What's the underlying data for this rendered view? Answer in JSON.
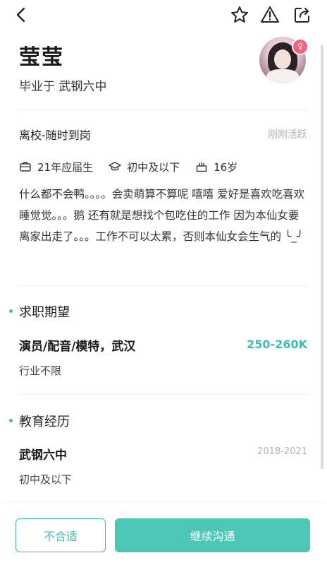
{
  "profile": {
    "name": "莹莹",
    "graduated": "毕业于 武钢六中",
    "gender_symbol": "♀"
  },
  "status": {
    "title": "离校-随时到岗",
    "active": "刚刚活跃"
  },
  "info": {
    "graduate_type": "21年应届生",
    "education": "初中及以下",
    "age": "16岁"
  },
  "bio": "什么都不会鸭。。。。会卖萌算不算呢 嘻嘻 爱好是喜欢吃喜欢睡觉觉。。。鹅 还有就是想找个包吃住的工作 因为本仙女要离家出走了。。。工作不可以太累，否则本仙女会生气的 ╰_╯",
  "expectation": {
    "section_title": "求职期望",
    "job": "演员/配音/模特，武汉",
    "salary": "250-260K",
    "industry": "行业不限"
  },
  "education_history": {
    "section_title": "教育经历",
    "school": "武钢六中",
    "years": "2018-2021",
    "level": "初中及以下"
  },
  "actions": {
    "reject_label": "不合适",
    "continue_label": "继续沟通"
  },
  "colors": {
    "accent": "#3cbfae",
    "accent_button": "#4ec6b6",
    "gender_badge": "#f4637c"
  },
  "icons": [
    "back-icon",
    "star-icon",
    "warning-icon",
    "share-icon",
    "briefcase-icon",
    "graduation-cap-icon",
    "age-icon"
  ]
}
